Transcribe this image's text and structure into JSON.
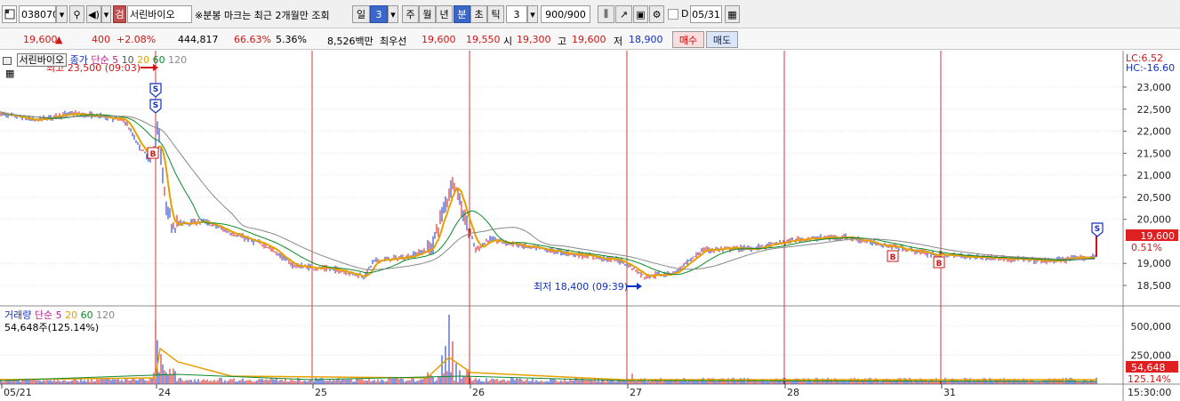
{
  "toolbar": {
    "code": "038070",
    "badge": "검",
    "name": "서린바이오",
    "notice": "※분봉 마크는 최근 2개월만 조회",
    "period_tabs": [
      "일",
      "주",
      "월",
      "년",
      "분",
      "초",
      "틱"
    ],
    "period_daily_num": "3",
    "interval_value": "3",
    "count_value": "900/900",
    "date_value": "05/31"
  },
  "quote": {
    "price": "19,600",
    "change": "400",
    "change_pct": "+2.08%",
    "volume": "444,817",
    "ratio1": "66.63%",
    "ratio2": "5.36%",
    "amount": "8,526백만",
    "best_label": "최우선",
    "best_ask": "19,600",
    "best_bid": "19,550",
    "open_label": "시",
    "open": "19,300",
    "high_label": "고",
    "high": "19,600",
    "low_label": "저",
    "low": "18,900",
    "buy_label": "매수",
    "sell_label": "매도"
  },
  "price_panel": {
    "name": "서린바이오",
    "close_label": "종가",
    "ma_label": "단순",
    "ma_periods": [
      "5",
      "10",
      "20",
      "60",
      "120"
    ],
    "high_note": "최고 23,500 (09:03)",
    "low_note": "최저 18,400 (09:39)",
    "lc": "LC:6.52",
    "hc": "HC:-16.60",
    "y_ticks": [
      "23,000",
      "22,500",
      "22,000",
      "21,500",
      "21,000",
      "20,500",
      "20,000",
      "19,000",
      "18,500"
    ],
    "current_price": "19,600",
    "current_pct": "0.51%"
  },
  "volume_panel": {
    "label": "거래량",
    "ma_label": "단순",
    "ma_periods": [
      "5",
      "20",
      "60",
      "120"
    ],
    "summary": "54,648주(125.14%)",
    "y_ticks": [
      "500,000",
      "250,000"
    ],
    "current": "54,648",
    "current_pct": "125.14%"
  },
  "x_axis": {
    "labels": [
      "05/21",
      "24",
      "25",
      "26",
      "27",
      "28",
      "31"
    ],
    "time": "15:30:00"
  },
  "colors": {
    "up": "#d21515",
    "down": "#1030c0",
    "ma5": "#e8a000",
    "ma20": "#0a8a2a",
    "ma60": "#888888"
  },
  "chart_data": {
    "type": "line",
    "title": "",
    "x": [
      "05/21",
      "24",
      "25",
      "26",
      "27",
      "28",
      "31"
    ],
    "series": [
      {
        "values": [
          22400,
          19800,
          18900,
          19700,
          18700,
          19100,
          19400
        ]
      }
    ],
    "volume": {
      "values": [
        30000,
        560000,
        20000,
        600000,
        60000,
        40000,
        54648
      ]
    },
    "ylim": [
      18300,
      23500
    ],
    "grid": true
  }
}
